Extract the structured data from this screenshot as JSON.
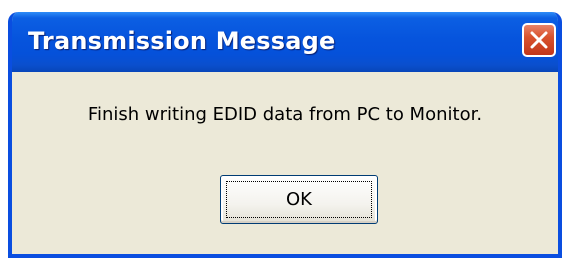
{
  "dialog": {
    "title": "Transmission Message",
    "message": "Finish writing EDID data from PC to Monitor.",
    "ok_label": "OK",
    "close_icon": "close-icon"
  },
  "colors": {
    "title_bar": "#0654dd",
    "dialog_body": "#ece9d8",
    "close_button": "#d9532e"
  }
}
